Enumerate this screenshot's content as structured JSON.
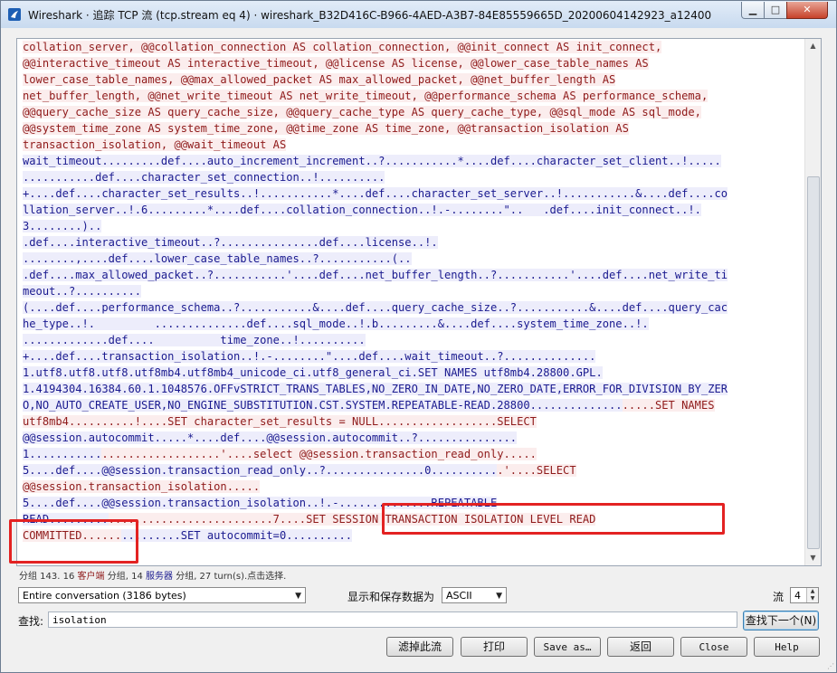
{
  "window": {
    "title": "Wireshark · 追踪 TCP 流 (tcp.stream eq 4) · wireshark_B32D416C-B966-4AED-A3B7-84E85559665D_20200604142923_a12400",
    "min_glyph": "▁",
    "max_glyph": "□",
    "close_glyph": "✕"
  },
  "stream": {
    "lines": [
      {
        "text": "collation_server, @@collation_connection AS collation_connection, @@init_connect AS init_connect,",
        "dir": "client"
      },
      {
        "text": "@@interactive_timeout AS interactive_timeout, @@license AS license, @@lower_case_table_names AS",
        "dir": "client"
      },
      {
        "text": "lower_case_table_names, @@max_allowed_packet AS max_allowed_packet, @@net_buffer_length AS",
        "dir": "client"
      },
      {
        "text": "net_buffer_length, @@net_write_timeout AS net_write_timeout, @@performance_schema AS performance_schema,",
        "dir": "client"
      },
      {
        "text": "@@query_cache_size AS query_cache_size, @@query_cache_type AS query_cache_type, @@sql_mode AS sql_mode,",
        "dir": "client"
      },
      {
        "text": "@@system_time_zone AS system_time_zone, @@time_zone AS time_zone, @@transaction_isolation AS",
        "dir": "client"
      },
      {
        "text": "transaction_isolation, @@wait_timeout AS",
        "dir": "client"
      },
      {
        "text": "wait_timeout.........def....auto_increment_increment..?...........*....def....character_set_client..!.....",
        "dir": "server"
      },
      {
        "text": "...........def....character_set_connection..!..........",
        "dir": "server"
      },
      {
        "text": "+....def....character_set_results..!...........*....def....character_set_server..!...........&....def....co",
        "dir": "server"
      },
      {
        "text": "llation_server..!.6.........*....def....collation_connection..!.-........\"..   .def....init_connect..!.",
        "dir": "server"
      },
      {
        "text": "3........)..",
        "dir": "server"
      },
      {
        "text": ".def....interactive_timeout..?...............def....license..!.",
        "dir": "server"
      },
      {
        "text": "........,....def....lower_case_table_names..?...........(..",
        "dir": "server"
      },
      {
        "text": ".def....max_allowed_packet..?...........'....def....net_buffer_length..?...........'....def....net_write_ti",
        "dir": "server"
      },
      {
        "text": "meout..?..........",
        "dir": "server"
      },
      {
        "text": "(....def....performance_schema..?...........&....def....query_cache_size..?...........&....def....query_cac",
        "dir": "server"
      },
      {
        "text": "he_type..!.         ..............def....sql_mode..!.b.........&....def....system_time_zone..!.",
        "dir": "server"
      },
      {
        "text": ".............def....          time_zone..!..........",
        "dir": "server"
      },
      {
        "text": "+....def....transaction_isolation..!.-........\"....def....wait_timeout..?..............",
        "dir": "server"
      },
      {
        "text": "1.utf8.utf8.utf8.utf8mb4.utf8mb4_unicode_ci.utf8_general_ci.SET NAMES utf8mb4.28800.GPL.",
        "dir": "server"
      },
      {
        "text": "1.4194304.16384.60.1.1048576.OFFvSTRICT_TRANS_TABLES,NO_ZERO_IN_DATE,NO_ZERO_DATE,ERROR_FOR_DIVISION_BY_ZER",
        "dir": "server"
      },
      {
        "text": "O,NO_AUTO_CREATE_USER,NO_ENGINE_SUBSTITUTION.CST.SYSTEM.REPEATABLE-READ.28800..............",
        "dir": "server",
        "tail": ".....SET NAMES",
        "tail_dir": "client"
      },
      {
        "text": "utf8mb4..........!....SET character_set_results = NULL.............",
        "dir": "client",
        "tail": ".....SELECT",
        "tail_dir": "client"
      },
      {
        "text": "@@session.autocommit.....*....def....@@session.autocommit..?...............",
        "dir": "server"
      },
      {
        "text": "1...........",
        "dir": "server",
        "tail": "..................'....select @@session.transaction_read_only.....",
        "tail_dir": "client"
      },
      {
        "text": "5....def....@@session.transaction_read_only..?...............0..........",
        "dir": "server",
        "tail": ".'....SELECT",
        "tail_dir": "client"
      },
      {
        "text": "@@session.transaction_isolation.....",
        "dir": "client"
      },
      {
        "text": "5....def....@@session.transaction_isolation..!.-..............REPEATABLE",
        "dir": "server"
      },
      {
        "text": "READ.........",
        "dir": "server",
        "tail": ".........................7....SET SESSION TRANSACTION ISOLATION LEVEL READ",
        "tail_dir": "client"
      },
      {
        "text": "COMMITTED......",
        "dir": "client",
        "tail": ".........SET autocommit=0..........",
        "tail_dir": "server"
      }
    ]
  },
  "status": {
    "prefix": "分组 143. 16",
    "client_label": "客户端",
    "mid": "分组, 14",
    "server_label": "服务器",
    "suffix": "分组, 27 turn(s).点击选择."
  },
  "controls": {
    "conversation_select": "Entire conversation (3186 bytes)",
    "display_label": "显示和保存数据为",
    "format_select": "ASCII",
    "stream_label": "流",
    "stream_value": "4",
    "find_label": "查找:",
    "find_value": "isolation",
    "find_next": "查找下一个(N)"
  },
  "buttons": {
    "filter_out": "滤掉此流",
    "print": "打印",
    "save_as": "Save as…",
    "back": "返回",
    "close": "Close",
    "help": "Help"
  },
  "colors": {
    "client_fg": "#8f1a1a",
    "client_bg": "#fbeded",
    "server_fg": "#1a1a8f",
    "server_bg": "#ededfb",
    "highlight": "#e32222"
  }
}
